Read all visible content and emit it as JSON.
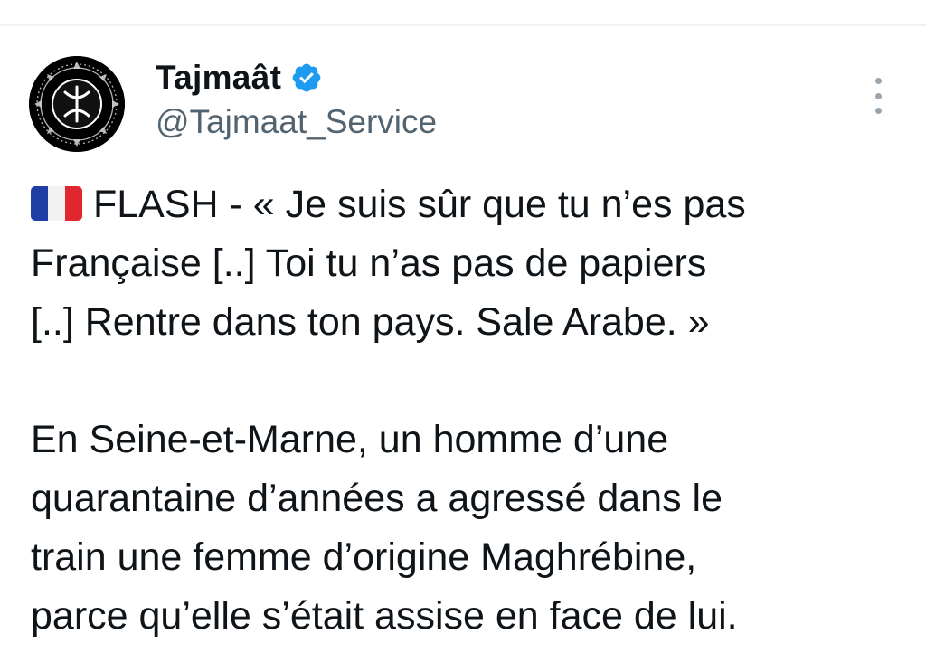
{
  "tweet": {
    "author": {
      "display_name": "Tajmaât",
      "handle": "@Tajmaat_Service",
      "verified": true,
      "avatar_icon": "yaz-symbol-icon",
      "verified_icon": "verified-badge-icon"
    },
    "more_icon": "more-options-icon",
    "flag_icon": "france-flag-icon",
    "text_lines": [
      "FLASH - « Je suis sûr que tu n’es pas",
      "Française [..] Toi tu n’as pas de papiers",
      "[..] Rentre dans ton pays. Sale Arabe. »",
      "",
      "En Seine-et-Marne, un homme d’une",
      "quarantaine d’années a agressé dans le",
      "train une femme d’origine Maghrébine,",
      "parce qu’elle s’était assise en face de lui."
    ]
  },
  "colors": {
    "text": "#0f1419",
    "secondary_text": "#536471",
    "verified_blue": "#1d9bf0",
    "divider": "#eff3f4",
    "background": "#ffffff"
  }
}
